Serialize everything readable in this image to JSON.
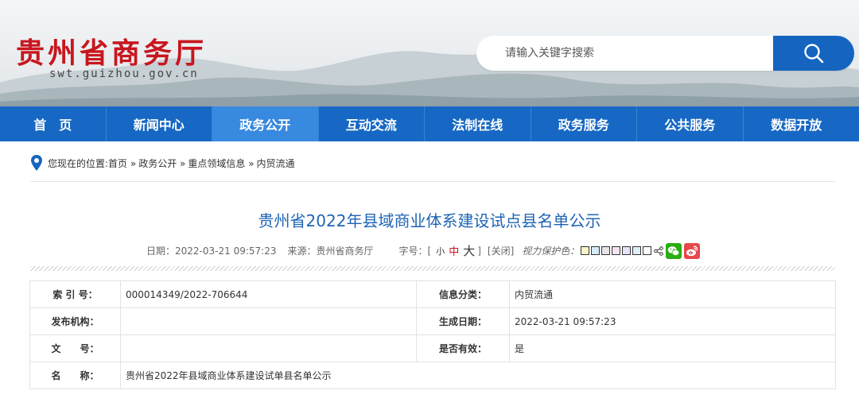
{
  "header": {
    "logo_cn": "贵州省商务厅",
    "logo_en": "swt.guizhou.gov.cn",
    "search_placeholder": "请输入关键字搜索",
    "search_icon": "search-icon"
  },
  "nav": {
    "items": [
      "首　页",
      "新闻中心",
      "政务公开",
      "互动交流",
      "法制在线",
      "政务服务",
      "公共服务",
      "数据开放"
    ],
    "active_index": 2,
    "color": "#1768c4",
    "active_color": "#3889e0"
  },
  "breadcrumb": {
    "prefix": "您现在的位置:首页 »",
    "items": [
      "政务公开 »",
      "重点领域信息 »",
      "内贸流通"
    ]
  },
  "article": {
    "title": "贵州省2022年县域商业体系建设试点县名单公示",
    "date_label": "日期：",
    "date": "2022-03-21 09:57:23",
    "source_label": "来源：",
    "source": "贵州省商务厅",
    "font_label": "字号：[",
    "font_small": "小",
    "font_mid": "中",
    "font_big": "大",
    "font_close": "]",
    "close": "[关闭]",
    "eye_label": "视力保护色：",
    "swatch_colors": [
      "#faf5c8",
      "#d6ecfb",
      "#e6e6e6",
      "#f6e2f0",
      "#e6e2f7",
      "#dfeef6",
      "#ffffff"
    ],
    "share_icon": "share-icon",
    "wechat_icon": "wechat-icon",
    "weibo_icon": "weibo-icon"
  },
  "info": {
    "rows": [
      {
        "label1": "索 引 号：",
        "value1": "000014349/2022-706644",
        "label2": "信息分类：",
        "value2": "内贸流通"
      },
      {
        "label1": "发布机构：",
        "value1": "",
        "label2": "生成日期：",
        "value2": "2022-03-21 09:57:23"
      },
      {
        "label1": "文　　号：",
        "value1": "",
        "label2": "是否有效：",
        "value2": "是"
      }
    ],
    "name_label": "名　　称：",
    "name_value": "贵州省2022年县域商业体系建设试单县名单公示"
  }
}
